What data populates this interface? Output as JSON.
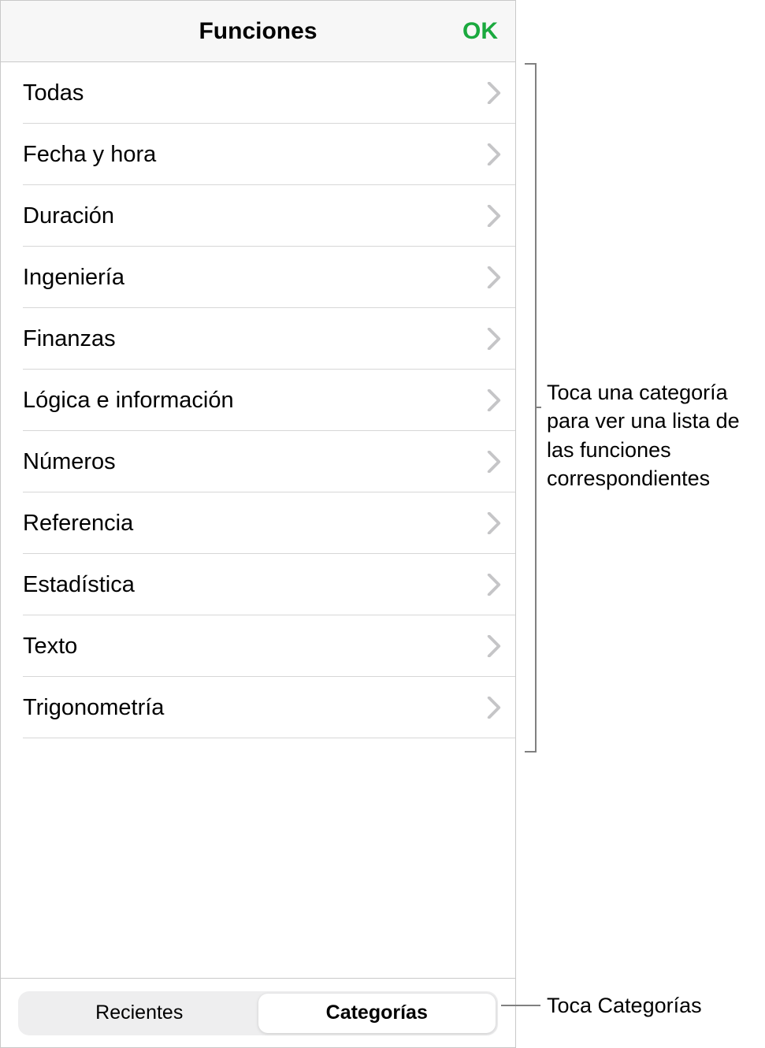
{
  "header": {
    "title": "Funciones",
    "ok_label": "OK"
  },
  "categories": [
    {
      "label": "Todas"
    },
    {
      "label": "Fecha y hora"
    },
    {
      "label": "Duración"
    },
    {
      "label": "Ingeniería"
    },
    {
      "label": "Finanzas"
    },
    {
      "label": "Lógica e información"
    },
    {
      "label": "Números"
    },
    {
      "label": "Referencia"
    },
    {
      "label": "Estadística"
    },
    {
      "label": "Texto"
    },
    {
      "label": "Trigonometría"
    }
  ],
  "footer": {
    "segments": [
      {
        "label": "Recientes",
        "active": false
      },
      {
        "label": "Categorías",
        "active": true
      }
    ]
  },
  "callouts": {
    "top": "Toca una categoría para ver una lista de las funciones correspondientes",
    "bottom": "Toca Categorías"
  }
}
